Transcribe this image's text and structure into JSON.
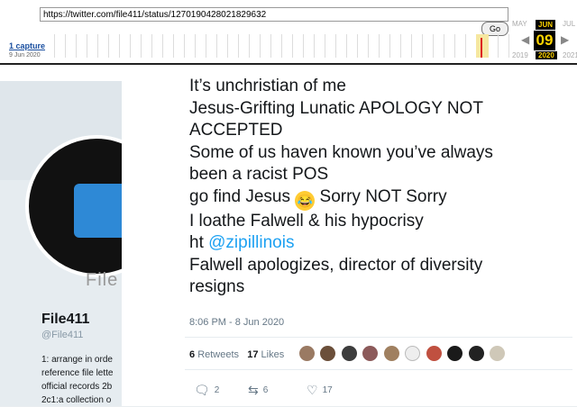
{
  "wayback": {
    "url": "https://twitter.com/file411/status/1270190428021829632",
    "go_label": "Go",
    "captures_label": "1 capture",
    "capture_date": "9 Jun 2020",
    "prev_month": "MAY",
    "cur_month": "JUN",
    "next_month": "JUL",
    "day": "09",
    "prev_year": "2019",
    "cur_year": "2020",
    "next_year": "2021"
  },
  "profile": {
    "name": "File411",
    "handle": "@File411",
    "avatar_text": "File",
    "bio_lines": [
      "1: arrange in orde",
      "reference file lette",
      "official records 2b",
      "2c1:a collection o"
    ]
  },
  "tweet": {
    "lines": [
      "It’s unchristian of me",
      "Jesus-Grifting Lunatic APOLOGY NOT",
      "ACCEPTED",
      "Some of us haven known you’ve always",
      "been a racist POS"
    ],
    "line_jesus_pre": "go find Jesus ",
    "line_jesus_post": " Sorry NOT Sorry",
    "emoji_name": "face-with-tears-of-joy",
    "line_loathe": " I loathe Falwell & his hypocrisy",
    "ht_prefix": "ht ",
    "ht_link": "@zipillinois",
    "line_falwell_1": "Falwell apologizes, director of diversity",
    "line_falwell_2": "resigns",
    "timestamp": "8:06 PM - 8 Jun 2020",
    "retweets_count": "6",
    "retweets_label": "Retweets",
    "likes_count": "17",
    "likes_label": "Likes",
    "replies": "2",
    "retweets_action": "6",
    "likes_action": "17"
  },
  "colors": {
    "link": "#1da1f2",
    "wayback_accent": "#ffd400"
  }
}
